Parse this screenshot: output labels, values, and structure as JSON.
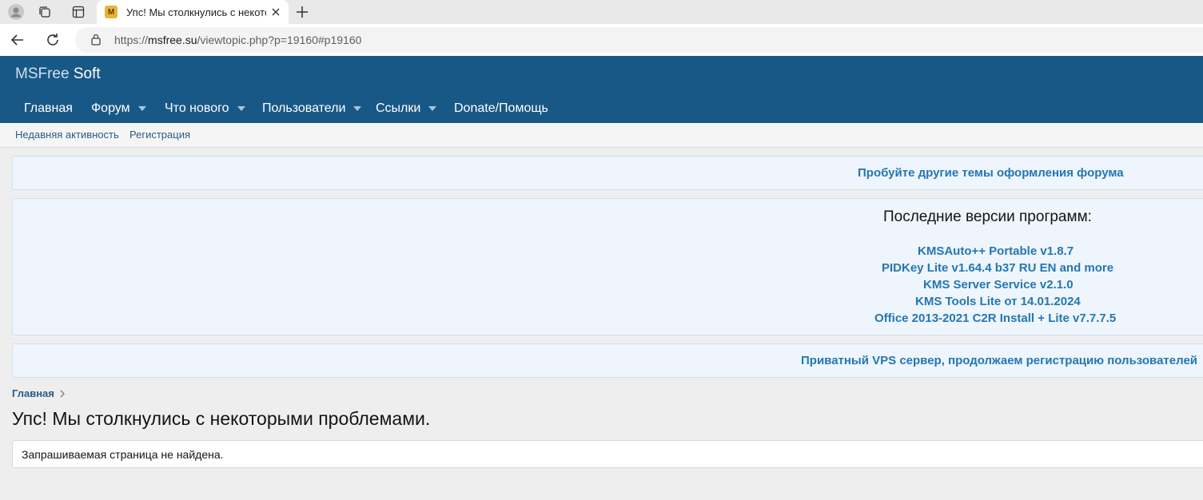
{
  "browser": {
    "tab_title": "Упс! Мы столкнулись с некоторыми проблемами.",
    "favicon_text": "M",
    "url_prefix": "https://",
    "url_host": "msfree.su",
    "url_path": "/viewtopic.php?p=19160#p19160"
  },
  "site": {
    "logo_part1": "MSFree",
    "logo_part2": "Soft",
    "nav": [
      {
        "label": "Главная"
      },
      {
        "label": "Форум"
      },
      {
        "label": "Что нового"
      },
      {
        "label": "Пользователи"
      },
      {
        "label": "Ссылки"
      },
      {
        "label": "Donate/Помощь"
      }
    ],
    "subnav": [
      "Недавняя активность",
      "Регистрация"
    ]
  },
  "notices": {
    "themes_link": "Пробуйте другие темы оформления форума",
    "versions_title": "Последние версии программ:",
    "versions": [
      "KMSAuto++ Portable v1.8.7",
      "PIDKey Lite v1.64.4 b37 RU EN and more",
      "KMS Server Service v2.1.0",
      "KMS Tools Lite от 14.01.2024",
      "Office 2013-2021 C2R Install + Lite v7.7.7.5"
    ],
    "vps_link": "Приватный VPS сервер, продолжаем регистрацию пользователей"
  },
  "content": {
    "breadcrumb": "Главная",
    "title": "Упс! Мы столкнулись с некоторыми проблемами.",
    "error_message": "Запрашиваемая страница не найдена."
  }
}
